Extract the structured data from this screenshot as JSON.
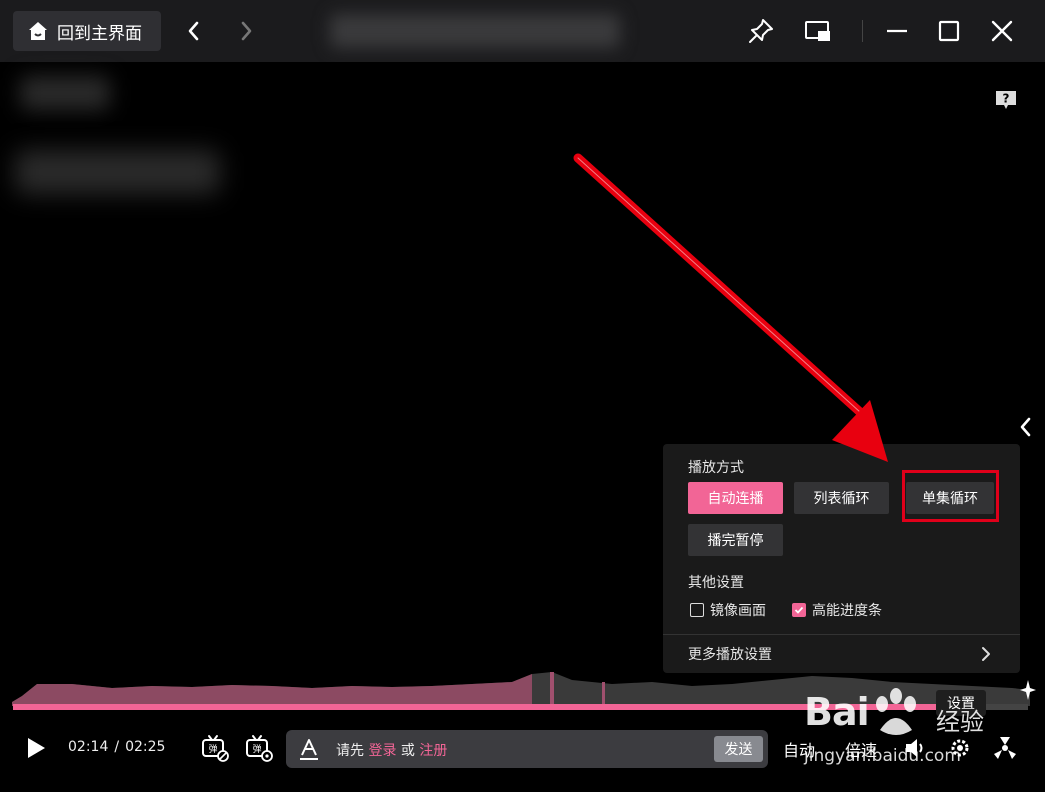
{
  "titlebar": {
    "home_label": "回到主界面",
    "icons": [
      "home-icon",
      "chevron-left-icon",
      "chevron-right-icon",
      "pin-icon",
      "mini-window-icon",
      "minimize-icon",
      "maximize-icon",
      "close-icon"
    ]
  },
  "settings_panel": {
    "play_mode_label": "播放方式",
    "play_modes": [
      {
        "label": "自动连播",
        "active": true
      },
      {
        "label": "列表循环",
        "active": false
      },
      {
        "label": "单集循环",
        "active": false
      },
      {
        "label": "播完暂停",
        "active": false
      }
    ],
    "other_label": "其他设置",
    "checkboxes": [
      {
        "label": "镜像画面",
        "checked": false
      },
      {
        "label": "高能进度条",
        "checked": true
      }
    ],
    "more_label": "更多播放设置"
  },
  "progress": {
    "fraction": 0.93,
    "tooltip": "设置"
  },
  "controls": {
    "current_time": "02:14",
    "separator": "/",
    "total_time": "02:25",
    "danmaku_hint_prefix": "请先",
    "login": "登录",
    "or": "或",
    "register": "注册",
    "send_label": "发送",
    "auto_label": "自动",
    "speed_label": "倍速"
  },
  "watermark": {
    "logo": "Bai",
    "jingyan": "经验",
    "url": "jingyan.baidu.com"
  },
  "colors": {
    "accent": "#f26596",
    "highlight_box": "#e0001a",
    "arrow": "#e8000f"
  }
}
